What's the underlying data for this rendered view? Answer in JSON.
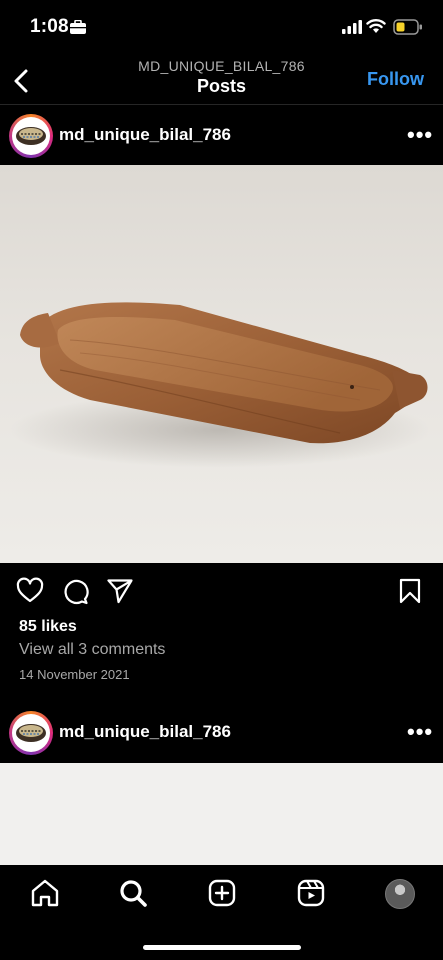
{
  "status": {
    "time": "1:08",
    "icons": [
      "briefcase-icon",
      "signal-icon",
      "wifi-icon",
      "battery-icon"
    ]
  },
  "header": {
    "subtitle": "MD_UNIQUE_BILAL_786",
    "title": "Posts",
    "follow_label": "Follow"
  },
  "posts": [
    {
      "username": "md_unique_bilal_786",
      "likes": "85 likes",
      "comments_link": "View all 3 comments",
      "date": "14 November 2021"
    },
    {
      "username": "md_unique_bilal_786"
    }
  ],
  "nav": {
    "items": [
      "home-icon",
      "search-icon",
      "create-icon",
      "reels-icon",
      "profile-icon"
    ]
  },
  "colors": {
    "accent": "#3897f0",
    "background": "#000000",
    "secondary_text": "#a8a8a8"
  }
}
